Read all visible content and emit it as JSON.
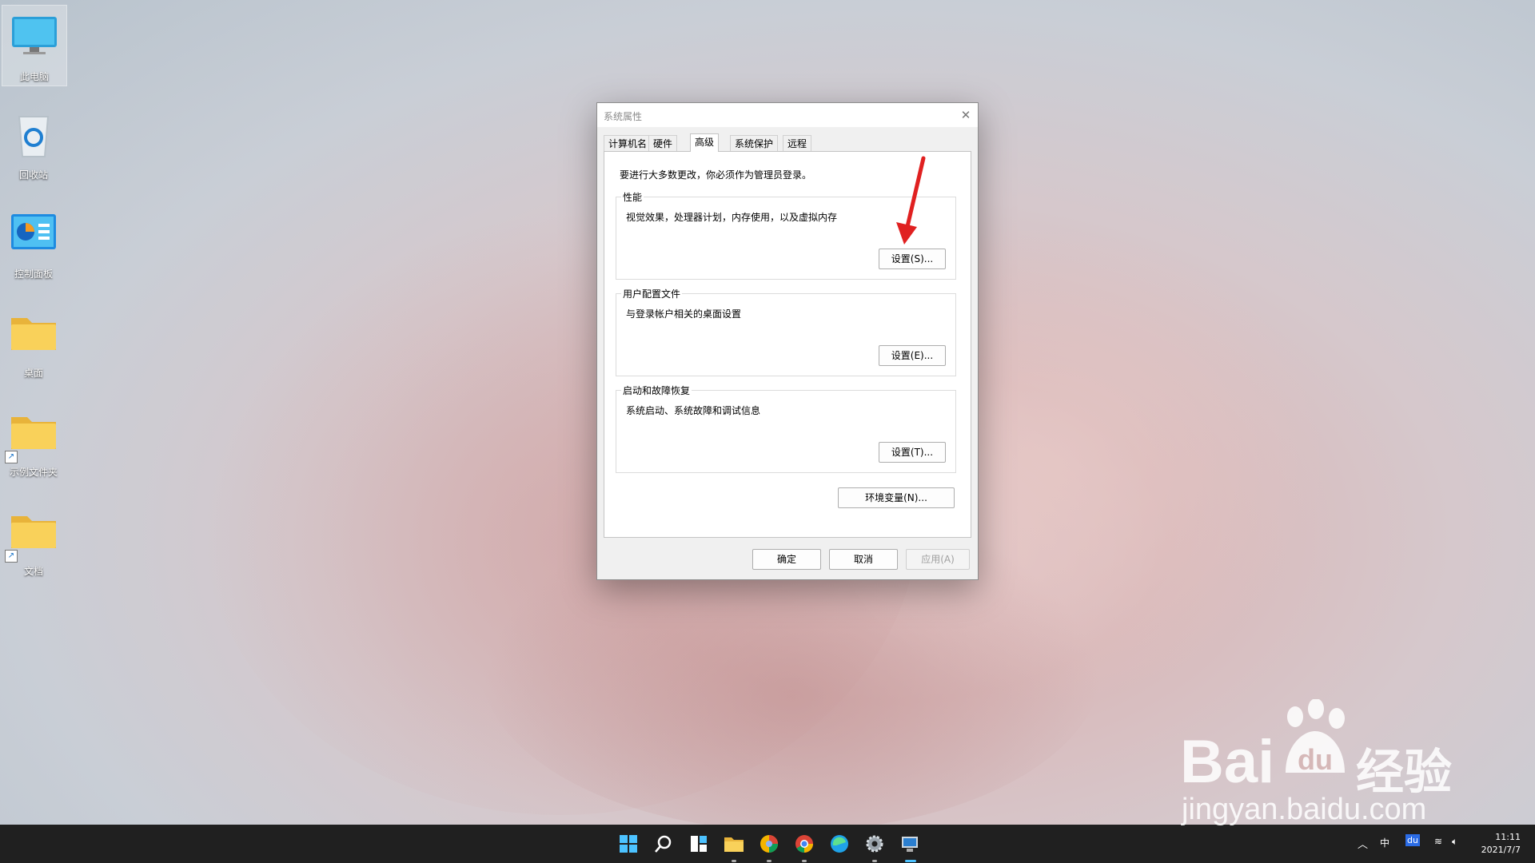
{
  "desktop": {
    "icons": [
      {
        "label": "此电脑",
        "icon": "this-pc-icon"
      },
      {
        "label": "回收站",
        "icon": "recycle-bin-icon"
      },
      {
        "label": "控制面板",
        "icon": "control-panel-icon"
      },
      {
        "label": "桌面",
        "icon": "folder-icon"
      },
      {
        "label": "示例文件夹",
        "icon": "folder-shortcut-icon"
      },
      {
        "label": "文档",
        "icon": "folder-shortcut-icon"
      }
    ]
  },
  "dialog": {
    "title": "系统属性",
    "tabs": [
      "计算机名",
      "硬件",
      "高级",
      "系统保护",
      "远程"
    ],
    "active_tab": "高级",
    "intro": "要进行大多数更改，你必须作为管理员登录。",
    "groups": [
      {
        "title": "性能",
        "desc": "视觉效果，处理器计划，内存使用，以及虚拟内存",
        "button": "设置(S)..."
      },
      {
        "title": "用户配置文件",
        "desc": "与登录帐户相关的桌面设置",
        "button": "设置(E)..."
      },
      {
        "title": "启动和故障恢复",
        "desc": "系统启动、系统故障和调试信息",
        "button": "设置(T)..."
      }
    ],
    "env_button": "环境变量(N)...",
    "footer": {
      "ok": "确定",
      "cancel": "取消",
      "apply": "应用(A)"
    }
  },
  "taskbar": {
    "tray": {
      "ime": "中",
      "baidu": "du"
    },
    "clock": {
      "time": "11:11",
      "date": "2021/7/7"
    }
  },
  "watermark": {
    "brand": "Bai",
    "brand2": "经验",
    "url": "jingyan.baidu.com"
  },
  "colors": {
    "accent": "#e02020",
    "taskbar": "#202020",
    "windows_blue": "#0078d4",
    "folder": "#f7c948"
  }
}
